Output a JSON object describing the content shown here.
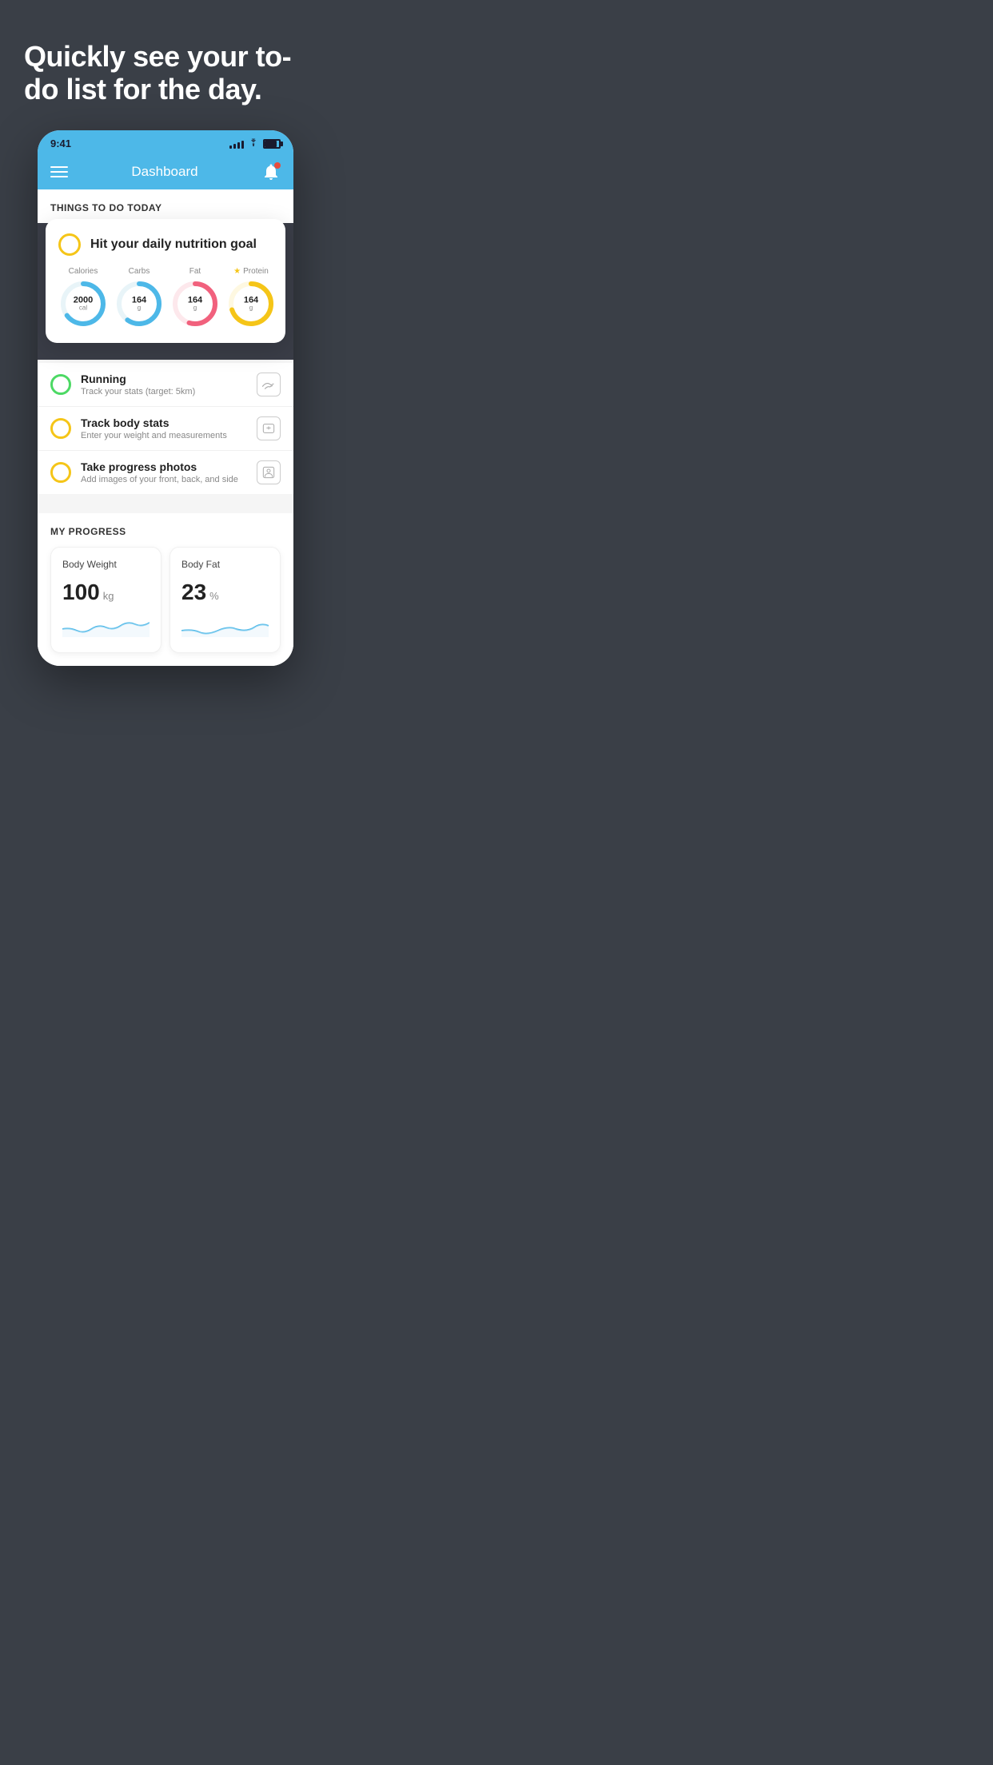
{
  "hero": {
    "title": "Quickly see your to-do list for the day."
  },
  "statusBar": {
    "time": "9:41",
    "signalBars": [
      4,
      6,
      8,
      10,
      12
    ],
    "batteryLevel": 85
  },
  "navBar": {
    "title": "Dashboard",
    "hasNotification": true
  },
  "thingsToDo": {
    "sectionTitle": "THINGS TO DO TODAY",
    "floatingCard": {
      "checkColor": "#f5c518",
      "title": "Hit your daily nutrition goal",
      "nutrients": [
        {
          "label": "Calories",
          "value": "2000",
          "unit": "cal",
          "color": "#4db8e8",
          "percent": 65,
          "highlighted": false
        },
        {
          "label": "Carbs",
          "value": "164",
          "unit": "g",
          "color": "#4db8e8",
          "percent": 60,
          "highlighted": false
        },
        {
          "label": "Fat",
          "value": "164",
          "unit": "g",
          "color": "#f1617d",
          "percent": 55,
          "highlighted": false
        },
        {
          "label": "Protein",
          "value": "164",
          "unit": "g",
          "color": "#f5c518",
          "percent": 70,
          "highlighted": true
        }
      ]
    },
    "listItems": [
      {
        "title": "Running",
        "subtitle": "Track your stats (target: 5km)",
        "circleColor": "green",
        "icon": "shoe"
      },
      {
        "title": "Track body stats",
        "subtitle": "Enter your weight and measurements",
        "circleColor": "yellow",
        "icon": "scale"
      },
      {
        "title": "Take progress photos",
        "subtitle": "Add images of your front, back, and side",
        "circleColor": "yellow",
        "icon": "person"
      }
    ]
  },
  "progress": {
    "sectionTitle": "MY PROGRESS",
    "cards": [
      {
        "title": "Body Weight",
        "value": "100",
        "unit": "kg",
        "sparkColor": "#4db8e8"
      },
      {
        "title": "Body Fat",
        "value": "23",
        "unit": "%",
        "sparkColor": "#4db8e8"
      }
    ]
  }
}
